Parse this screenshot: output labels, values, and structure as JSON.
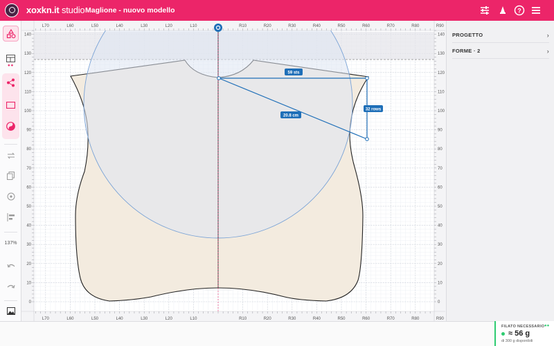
{
  "header": {
    "brand_name": "xoxkn.it",
    "brand_suffix": "studio",
    "document_title": "Maglione - nuovo modello",
    "icons": [
      "sliders-icon",
      "bell-icon",
      "help-icon",
      "menu-icon"
    ]
  },
  "toolbar": {
    "tools": [
      "shapes-icon",
      "layout-icon",
      "share-icon",
      "rectangle-icon",
      "color-icon",
      "swap-icon",
      "copy-icon",
      "target-icon",
      "align-icon",
      "undo-icon",
      "redo-icon",
      "image-icon"
    ],
    "zoom_label": "137%"
  },
  "canvas": {
    "ruler_x_labels": [
      "L70",
      "L60",
      "L50",
      "L40",
      "L30",
      "L20",
      "L10",
      "R10",
      "R20",
      "R30",
      "R40",
      "R50",
      "R60",
      "R70",
      "R80",
      "R90"
    ],
    "ruler_y_labels": [
      "140",
      "130",
      "120",
      "110",
      "100",
      "90",
      "80",
      "70",
      "60",
      "50",
      "40",
      "30",
      "20",
      "10",
      "0"
    ],
    "measurements": {
      "stitches": "59 sts",
      "rows": "32 rows",
      "diagonal": "20.8 cm"
    },
    "colors": {
      "piece_fill": "#f3ebdf",
      "measure_blue": "#1f6fb8",
      "circle_fill": "#dfe6f2"
    }
  },
  "right_panel": {
    "sections": [
      {
        "label": "PROGETTO"
      },
      {
        "label": "FORME · 2"
      }
    ]
  },
  "status": {
    "yarn_label": "FILATO NECESSARIO",
    "yarn_amount": "≈ 56 g",
    "yarn_available": "di 300 g disponibili"
  }
}
